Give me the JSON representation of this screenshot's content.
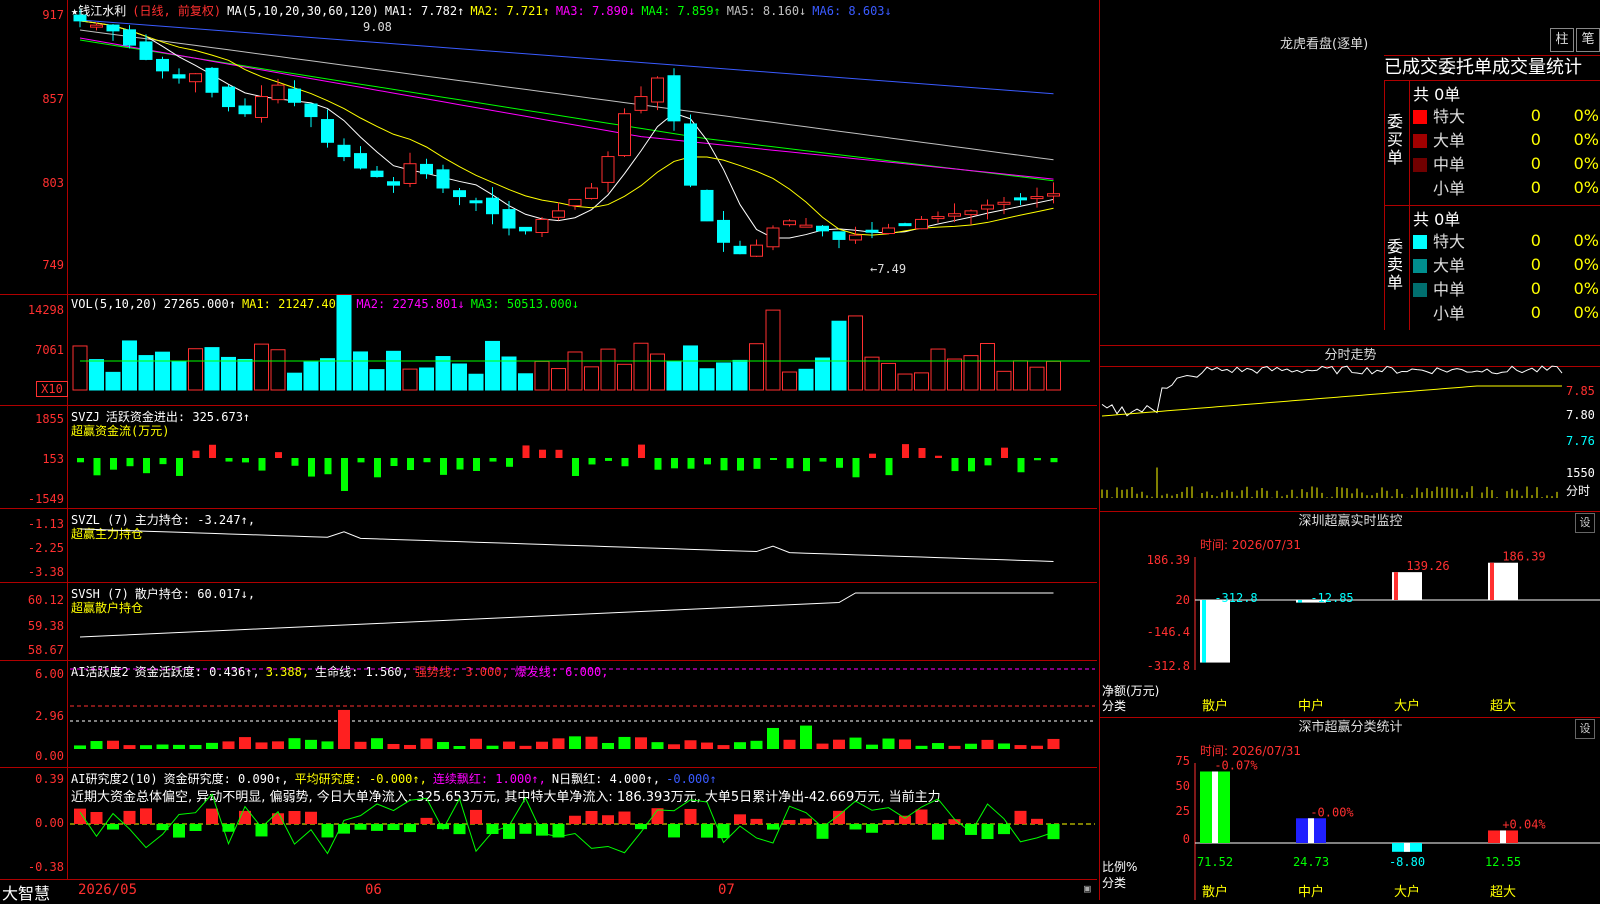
{
  "stock": {
    "name": "★钱江水利",
    "period": "(日线, 前复权)"
  },
  "main": {
    "ma_label": "MA(5,10,20,30,60,120)",
    "ma": [
      {
        "t": "MA1: 7.782↑",
        "c": "#ffffff"
      },
      {
        "t": "MA2: 7.721↑",
        "c": "#ffff00"
      },
      {
        "t": "MA3: 7.890↓",
        "c": "#ff00ff"
      },
      {
        "t": "MA4: 7.859↑",
        "c": "#00ff00"
      },
      {
        "t": "MA5: 8.160↓",
        "c": "#c0c0c0"
      },
      {
        "t": "MA6: 8.603↓",
        "c": "#3a5bff"
      }
    ],
    "yticks": [
      "917",
      "857",
      "803",
      "749"
    ],
    "high_note": "9.08",
    "low_note": "←7.49"
  },
  "vol": {
    "label": "VOL(5,10,20)",
    "items": [
      {
        "t": "27265.000↑",
        "c": "#ffffff"
      },
      {
        "t": "MA1: 21247.400↑",
        "c": "#ffff00"
      },
      {
        "t": "MA2: 22745.801↓",
        "c": "#ff00ff"
      },
      {
        "t": "MA3: 50513.000↓",
        "c": "#00ff00"
      }
    ],
    "yticks": [
      "14298",
      "7061",
      "X10"
    ]
  },
  "svzj": {
    "label": "SVZJ",
    "items": [
      {
        "t": "活跃资金进出: 325.673↑",
        "c": "#ffffff"
      }
    ],
    "note": "超赢资金流(万元)",
    "yticks": [
      "1855",
      "153",
      "-1549"
    ]
  },
  "svzl": {
    "label": "SVZL (7)",
    "items": [
      {
        "t": "主力持仓: -3.247↑,",
        "c": "#ffffff"
      }
    ],
    "note": "超赢主力持仓",
    "yticks": [
      "-1.13",
      "-2.25",
      "-3.38"
    ]
  },
  "svsh": {
    "label": "SVSH (7)",
    "items": [
      {
        "t": "散户持仓: 60.017↓,",
        "c": "#ffffff"
      }
    ],
    "note": "超赢散户持仓",
    "yticks": [
      "60.12",
      "59.38",
      "58.67"
    ]
  },
  "ai1": {
    "label": "AI活跃度2",
    "items": [
      {
        "t": "资金活跃度: 0.436↑,",
        "c": "#ffffff"
      },
      {
        "t": "3.388,",
        "c": "#ffff00"
      },
      {
        "t": "生命线: 1.560,",
        "c": "#ffffff"
      },
      {
        "t": "强势线: 3.000,",
        "c": "#ff3030"
      },
      {
        "t": "爆发线: 6.000,",
        "c": "#ff00ff"
      }
    ],
    "yticks": [
      "6.00",
      "2.96",
      "0.00"
    ]
  },
  "ai2": {
    "label": "AI研究度2(10)",
    "items": [
      {
        "t": "资金研究度: 0.090↑,",
        "c": "#ffffff"
      },
      {
        "t": "平均研究度: -0.000↑,",
        "c": "#ffff00"
      },
      {
        "t": "连续飘红: 1.000↑,",
        "c": "#ff00ff"
      },
      {
        "t": "N日飘红: 4.000↑,",
        "c": "#ffffff"
      },
      {
        "t": "-0.000↑",
        "c": "#3a5bff"
      }
    ],
    "comment": "近期大资金总体偏空, 异动不明显, 偏弱势, 今日大单净流入: 325.653万元, 其中特大单净流入: 186.393万元, 大单5日累计净出-42.669万元, 当前主力",
    "yticks": [
      "0.39",
      "0.00",
      "-0.38"
    ]
  },
  "xaxis": {
    "brand": "大智慧",
    "dates": [
      "2026/05",
      "06",
      "07"
    ]
  },
  "lhb": {
    "title": "龙虎看盘(逐单)",
    "btn1": "柱",
    "btn2": "笔",
    "header": "已成交委托单成交量统计",
    "buy": {
      "side": "委买单",
      "total": "共 0单",
      "rows": [
        {
          "n": "特大",
          "v": "0",
          "p": "0%",
          "c": "#ff0000"
        },
        {
          "n": "大单",
          "v": "0",
          "p": "0%",
          "c": "#a00000"
        },
        {
          "n": "中单",
          "v": "0",
          "p": "0%",
          "c": "#700000"
        },
        {
          "n": "小单",
          "v": "0",
          "p": "0%",
          "c": "#000000"
        }
      ]
    },
    "sell": {
      "side": "委卖单",
      "total": "共 0单",
      "rows": [
        {
          "n": "特大",
          "v": "0",
          "p": "0%",
          "c": "#00ffff"
        },
        {
          "n": "大单",
          "v": "0",
          "p": "0%",
          "c": "#008f8f"
        },
        {
          "n": "中单",
          "v": "0",
          "p": "0%",
          "c": "#006f6f"
        },
        {
          "n": "小单",
          "v": "0",
          "p": "0%",
          "c": "#000000"
        }
      ]
    }
  },
  "fs": {
    "title": "分时走势",
    "yticks": [
      "7.85",
      "7.80",
      "7.76"
    ],
    "vol": "1550",
    "unit": "分时"
  },
  "sz": {
    "title": "深圳超赢实时监控",
    "gear": "设",
    "time": "时间: 2026/07/31",
    "yticks": [
      "186.39",
      "20",
      "-146.4",
      "-312.8"
    ],
    "bars": [
      {
        "cat": "散户",
        "v": -312.8,
        "label": "-312.8"
      },
      {
        "cat": "中户",
        "v": -12.85,
        "label": "-12.85"
      },
      {
        "cat": "大户",
        "v": 139.26,
        "label": "139.26"
      },
      {
        "cat": "超大",
        "v": 186.39,
        "label": "186.39"
      }
    ],
    "unit1": "净额(万元)",
    "unit2": "分类"
  },
  "ss": {
    "title": "深市超赢分类统计",
    "gear": "设",
    "time": "时间: 2026/07/31",
    "yticks": [
      "75",
      "50",
      "25",
      "0"
    ],
    "bars": [
      {
        "cat": "散户",
        "v": 71.52,
        "top": "-0.07%",
        "bottom": "71.52",
        "c": "#00ff00"
      },
      {
        "cat": "中户",
        "v": 24.73,
        "top": "-0.00%",
        "bottom": "24.73",
        "c": "#2020ff"
      },
      {
        "cat": "大户",
        "v": -8.8,
        "top": "",
        "bottom": "-8.80",
        "c": "#00ffff"
      },
      {
        "cat": "超大",
        "v": 12.55,
        "top": "+0.04%",
        "bottom": "12.55",
        "c": "#ff2020"
      }
    ],
    "unit1": "比例%",
    "unit2": "分类"
  }
}
